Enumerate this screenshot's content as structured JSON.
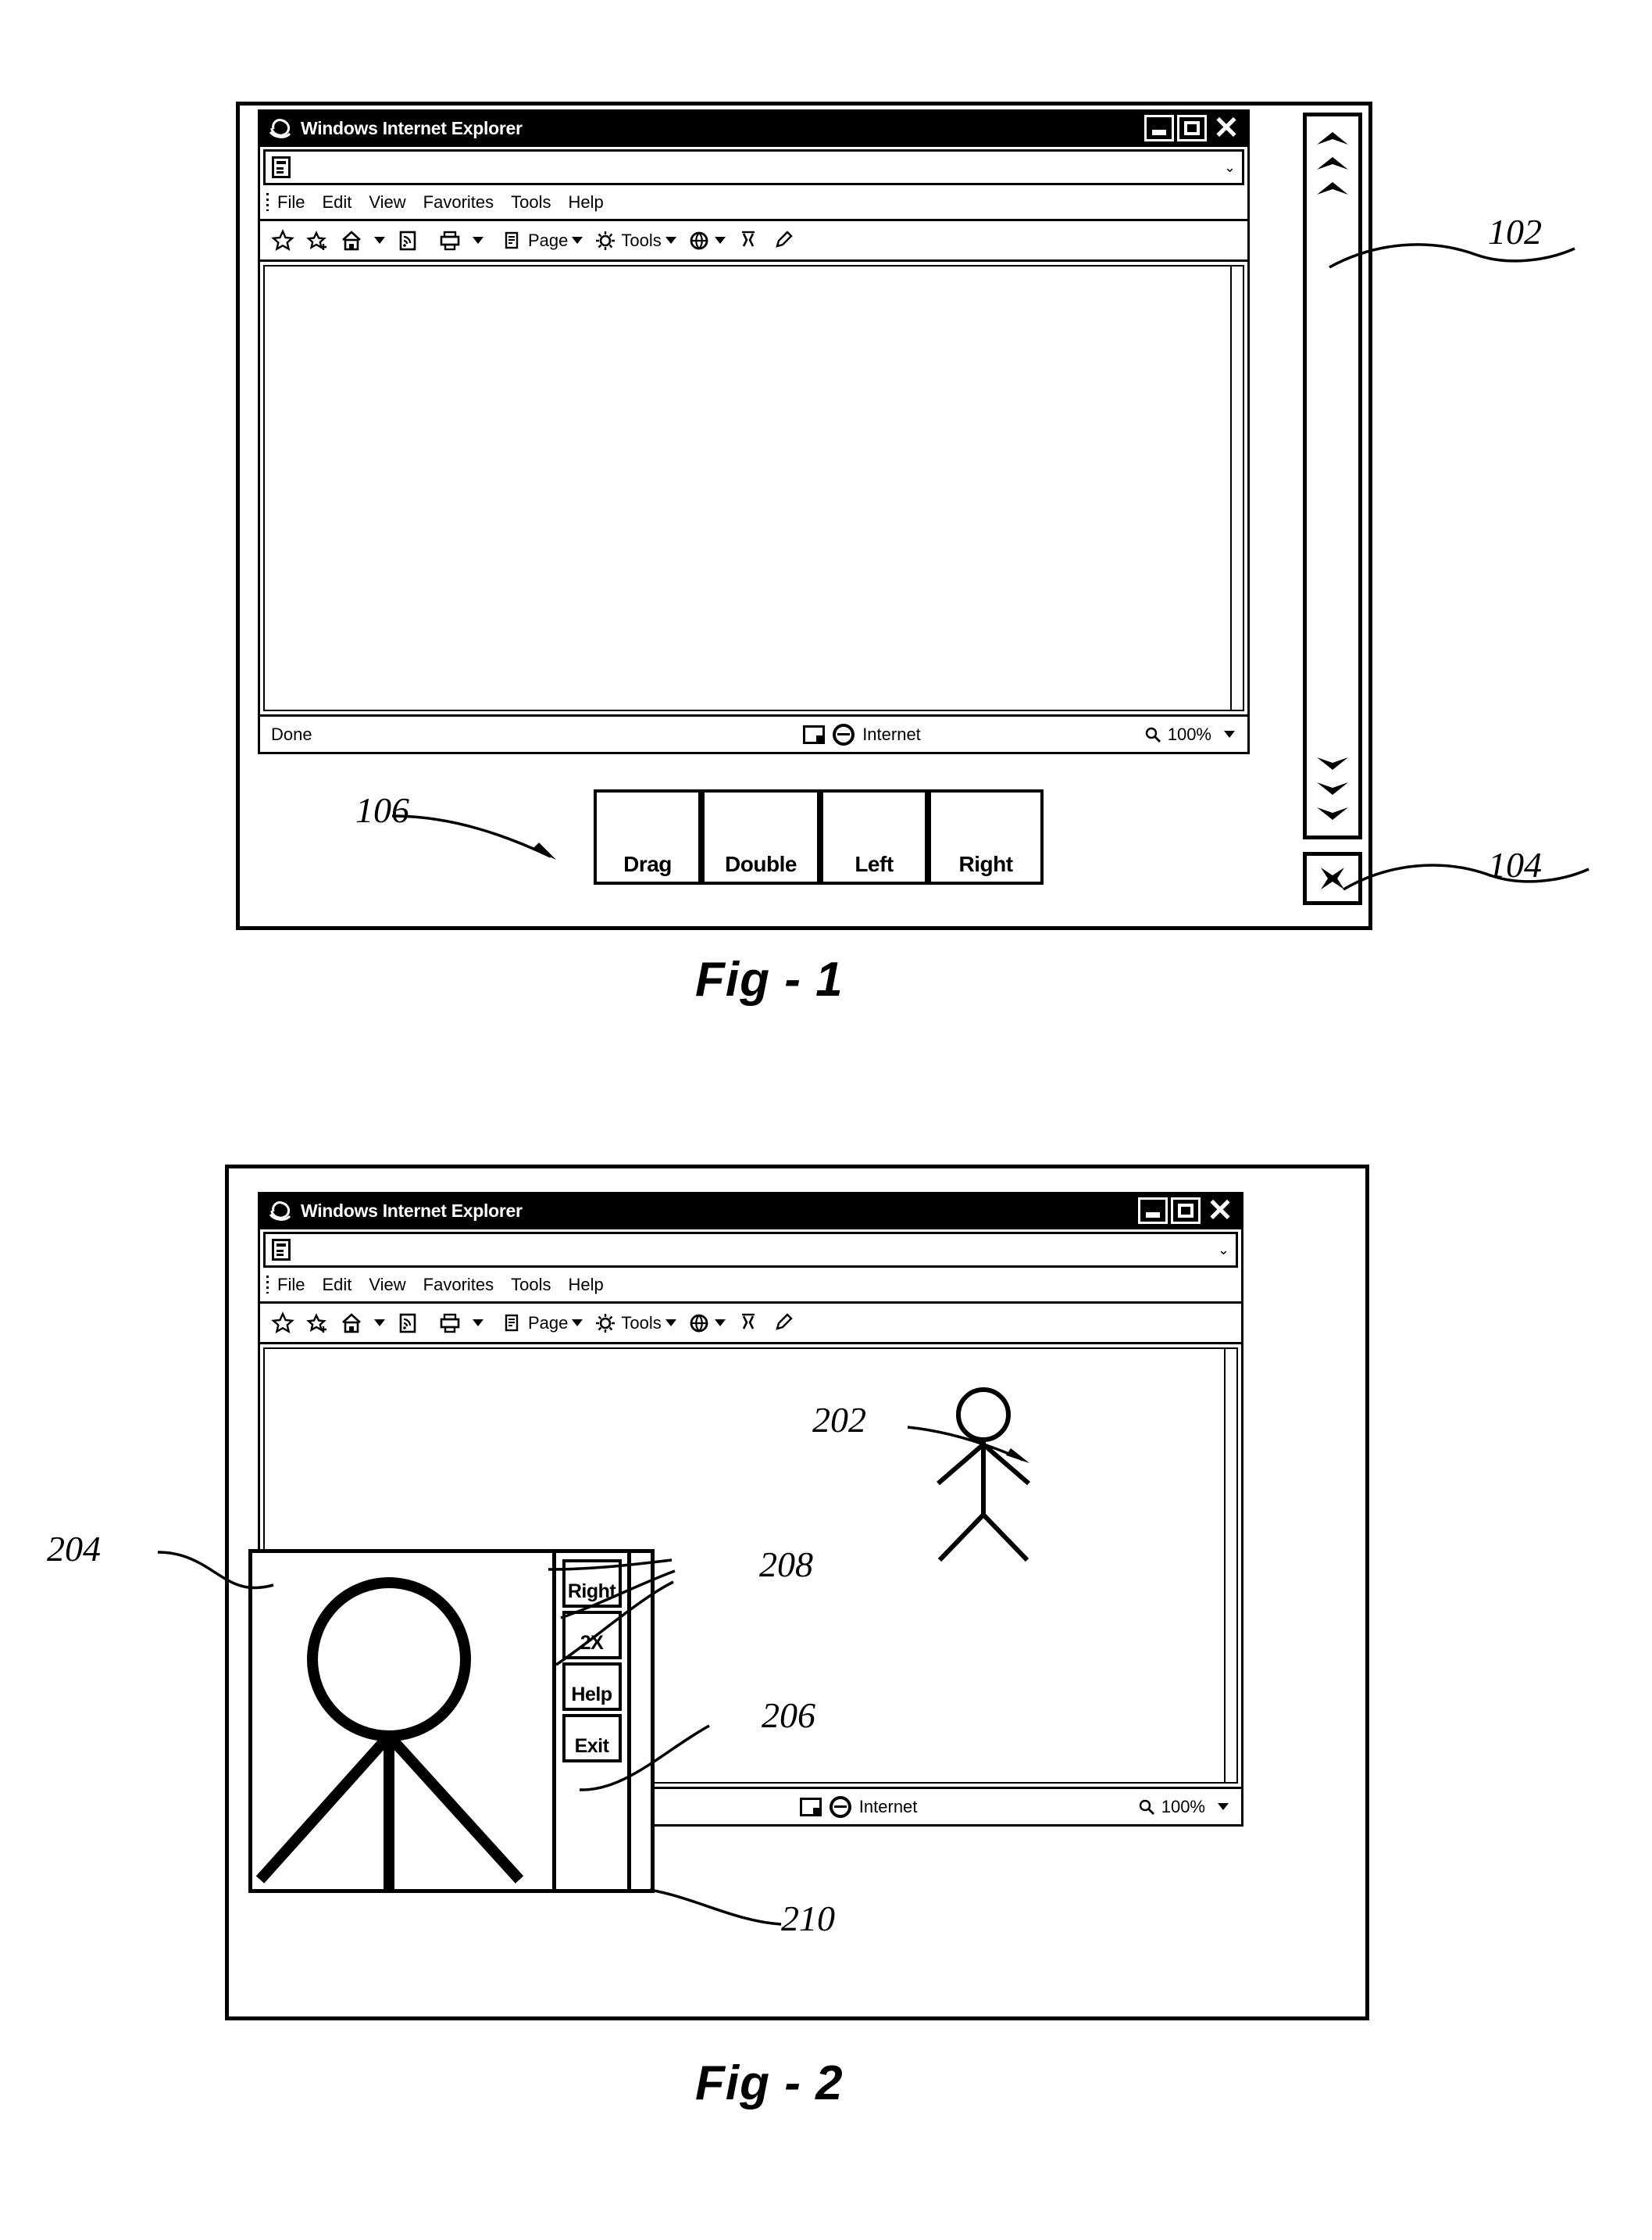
{
  "document": {
    "type": "patent-drawing-sheet",
    "figures": [
      "Fig - 1",
      "Fig - 2"
    ]
  },
  "browser": {
    "title": "Windows Internet Explorer",
    "logo_icon": "internet-explorer-logo-icon",
    "window_buttons": [
      {
        "name": "minimize-button",
        "glyph": "_"
      },
      {
        "name": "maximize-button",
        "glyph": "□"
      },
      {
        "name": "close-button",
        "glyph": "X"
      }
    ],
    "address_bar": {
      "icon": "page-icon",
      "value": "",
      "placeholder": "",
      "dropdown_icon": "chevron-down-icon"
    },
    "menu_items": [
      "File",
      "Edit",
      "View",
      "Favorites",
      "Tools",
      "Help"
    ],
    "command_bar": {
      "icons": [
        "favorites-star-icon",
        "add-to-favorites-icon",
        "home-icon",
        "home-dropdown-caret-icon",
        "feeds-icon",
        "print-icon",
        "print-dropdown-caret-icon"
      ],
      "page_label": "Page",
      "page_caret": "chevron-down-icon",
      "tools_label": "Tools",
      "tools_caret": "chevron-down-icon",
      "help_globe_icon": "globe-help-icon",
      "help_caret": "chevron-down-icon",
      "extra_icons": [
        "messenger-icon",
        "edit-page-icon"
      ]
    },
    "status_bar": {
      "status_text": "Done",
      "zone_icon": "protected-mode-icon",
      "zone_globe_icon": "internet-zone-globe-icon",
      "zone_label": "Internet",
      "zoom_icon": "magnifier-icon",
      "zoom_level": "100%",
      "zoom_caret": "chevron-down-icon"
    }
  },
  "fig1": {
    "caption": "Fig - 1",
    "scroll_panel": {
      "name": "chevron-scroll-panel",
      "up_chevrons": 3,
      "down_chevrons": 3,
      "up_icon": "chevron-up-icon",
      "down_icon": "chevron-down-icon"
    },
    "close_box": {
      "name": "close-box",
      "icon": "close-x-icon"
    },
    "action_buttons": [
      {
        "label": "Drag",
        "name": "drag-button"
      },
      {
        "label": "Double",
        "name": "double-click-button"
      },
      {
        "label": "Left",
        "name": "left-click-button"
      },
      {
        "label": "Right",
        "name": "right-click-button"
      }
    ],
    "callouts": [
      {
        "number": "102",
        "target": "chevron-scroll-panel"
      },
      {
        "number": "104",
        "target": "close-box"
      },
      {
        "number": "106",
        "target": "action-button-row"
      }
    ]
  },
  "fig2": {
    "caption": "Fig - 2",
    "page_figure": {
      "name": "stick-figure-graphic",
      "description": "stick figure with head, torso, two arms and two legs"
    },
    "magnifier_overlay": {
      "name": "magnifier-overlay-window",
      "zoomed_figure": "zoomed-stick-figure-graphic",
      "buttons": [
        {
          "label": "Right",
          "name": "right-click-button"
        },
        {
          "label": "2X",
          "name": "zoom-2x-button"
        },
        {
          "label": "Help",
          "name": "help-button"
        },
        {
          "label": "Exit",
          "name": "exit-button"
        }
      ]
    },
    "callouts": [
      {
        "number": "202",
        "target": "stick-figure-graphic"
      },
      {
        "number": "204",
        "target": "magnifier-overlay-window"
      },
      {
        "number": "206",
        "target": "exit-button"
      },
      {
        "number": "208",
        "target": "overlay-button-group"
      },
      {
        "number": "210",
        "target": "overlay-sidebar"
      }
    ]
  }
}
